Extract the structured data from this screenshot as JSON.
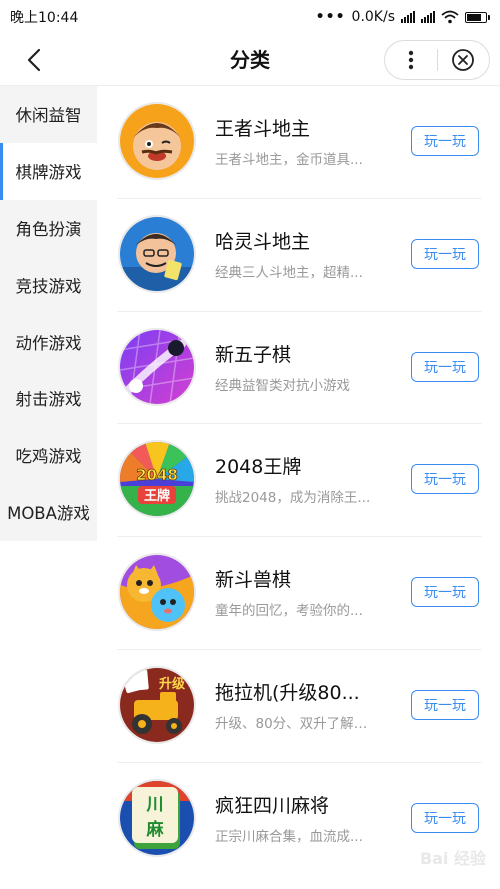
{
  "status_bar": {
    "time": "晚上10:44",
    "more": "•••",
    "net_speed": "0.0K/s"
  },
  "header": {
    "title": "分类"
  },
  "categories": [
    {
      "label": "休闲益智",
      "active": false
    },
    {
      "label": "棋牌游戏",
      "active": true
    },
    {
      "label": "角色扮演",
      "active": false
    },
    {
      "label": "竞技游戏",
      "active": false
    },
    {
      "label": "动作游戏",
      "active": false
    },
    {
      "label": "射击游戏",
      "active": false
    },
    {
      "label": "吃鸡游戏",
      "active": false
    },
    {
      "label": "MOBA游戏",
      "active": false
    }
  ],
  "games": [
    {
      "name": "王者斗地主",
      "desc": "王者斗地主，金币道具...",
      "button": "玩一玩",
      "icon": "doudizhu-king-icon"
    },
    {
      "name": "哈灵斗地主",
      "desc": "经典三人斗地主，超精...",
      "button": "玩一玩",
      "icon": "haling-doudizhu-icon"
    },
    {
      "name": "新五子棋",
      "desc": "经典益智类对抗小游戏",
      "button": "玩一玩",
      "icon": "gomoku-icon"
    },
    {
      "name": "2048王牌",
      "desc": "挑战2048，成为消除王...",
      "button": "玩一玩",
      "icon": "game-2048-icon",
      "icon_text": "2048",
      "icon_text2": "王牌"
    },
    {
      "name": "新斗兽棋",
      "desc": "童年的回忆，考验你的...",
      "button": "玩一玩",
      "icon": "animal-chess-icon"
    },
    {
      "name": "拖拉机(升级80...",
      "desc": "升级、80分、双升了解一...",
      "button": "玩一玩",
      "icon": "tractor-cards-icon",
      "icon_text": "升级"
    },
    {
      "name": "疯狂四川麻将",
      "desc": "正宗川麻合集，血流成...",
      "button": "玩一玩",
      "icon": "sichuan-mahjong-icon",
      "icon_text": "川",
      "icon_text2": "麻"
    }
  ],
  "watermark": "Bai 经验",
  "colors": {
    "accent": "#3a8cf0",
    "sidebar_bg": "#f4f4f4",
    "desc_text": "#999999"
  }
}
